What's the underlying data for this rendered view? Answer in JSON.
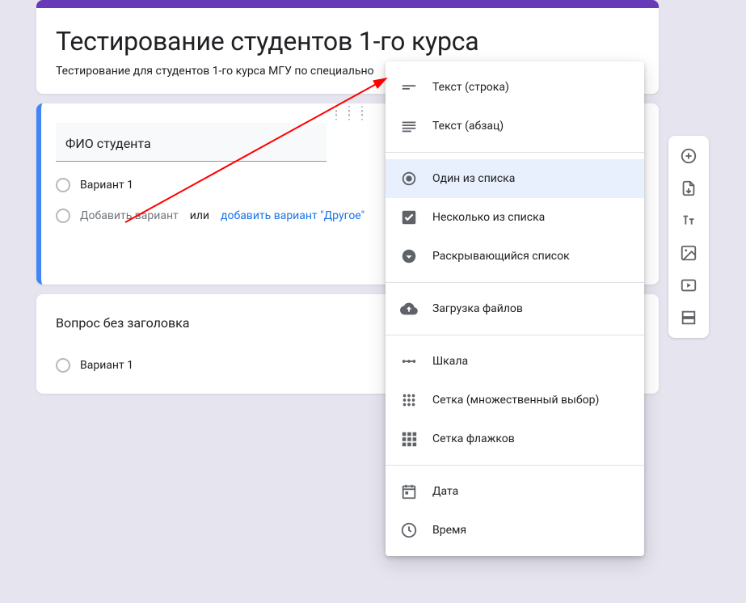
{
  "form": {
    "title": "Тестирование студентов 1-го курса",
    "description": "Тестирование для студентов 1-го курса МГУ по специально"
  },
  "question_active": {
    "title": "ФИО студента",
    "option1": "Вариант 1",
    "add_option": "Добавить вариант",
    "or": "или",
    "add_other": "добавить вариант \"Другое\""
  },
  "question_inactive": {
    "title": "Вопрос без заголовка",
    "option1": "Вариант 1"
  },
  "menu": {
    "short_text": "Текст (строка)",
    "paragraph": "Текст (абзац)",
    "radio": "Один из списка",
    "checkbox": "Несколько из списка",
    "dropdown": "Раскрывающийся список",
    "upload": "Загрузка файлов",
    "scale": "Шкала",
    "grid_radio": "Сетка (множественный выбор)",
    "grid_check": "Сетка флажков",
    "date": "Дата",
    "time": "Время"
  }
}
